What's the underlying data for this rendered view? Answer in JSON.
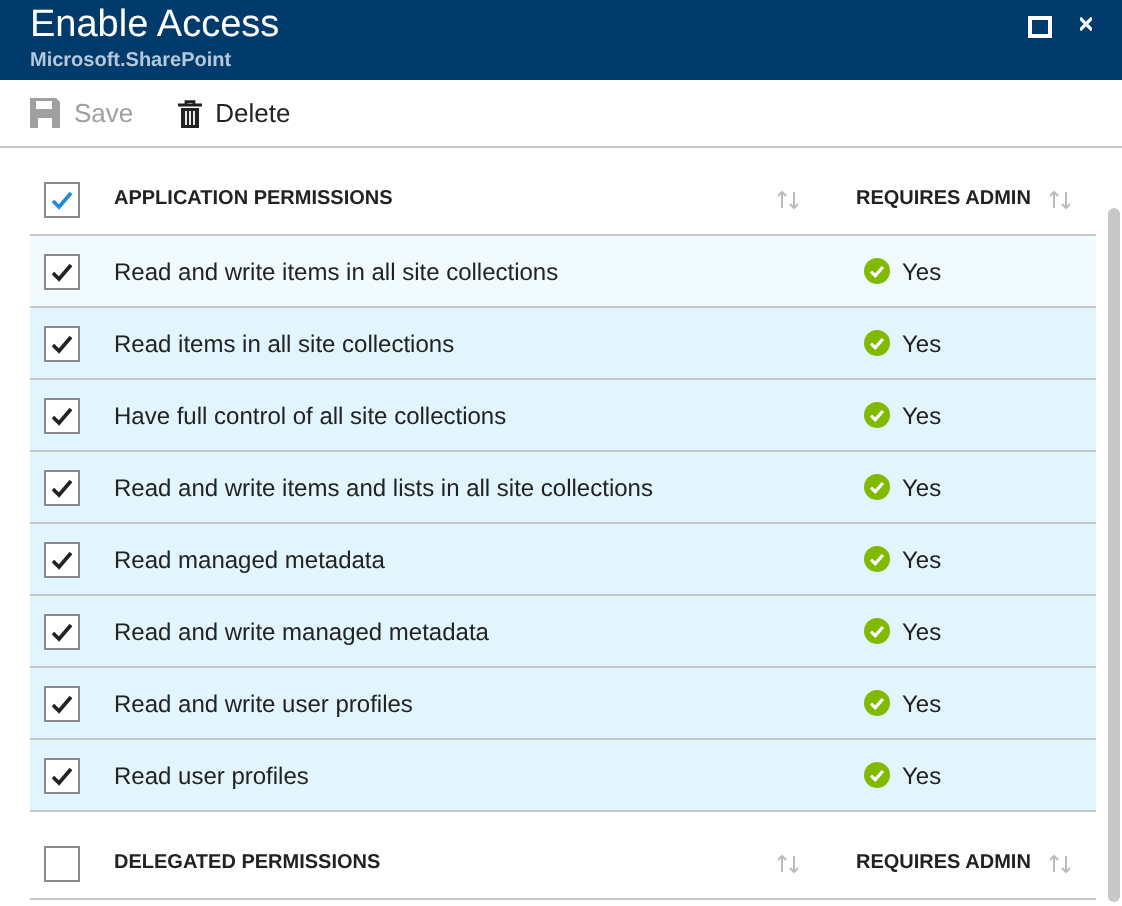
{
  "window": {
    "title": "Enable Access",
    "subtitle": "Microsoft.SharePoint"
  },
  "toolbar": [
    {
      "label": "Save",
      "disabled": true,
      "kind": "save"
    },
    {
      "label": "Delete",
      "disabled": false,
      "kind": "delete"
    }
  ],
  "sections": [
    {
      "all_checked": true,
      "columns": [
        "APPLICATION PERMISSIONS",
        "REQUIRES ADMIN"
      ],
      "rows": [
        {
          "name": "Read and write items in all site collections",
          "checked": true,
          "hovered": true,
          "requires_admin": "Yes"
        },
        {
          "name": "Read items in all site collections",
          "checked": true,
          "hovered": false,
          "requires_admin": "Yes"
        },
        {
          "name": "Have full control of all site collections",
          "checked": true,
          "hovered": false,
          "requires_admin": "Yes"
        },
        {
          "name": "Read and write items and lists in all site collections",
          "checked": true,
          "hovered": false,
          "requires_admin": "Yes"
        },
        {
          "name": "Read managed metadata",
          "checked": true,
          "hovered": false,
          "requires_admin": "Yes"
        },
        {
          "name": "Read and write managed metadata",
          "checked": true,
          "hovered": false,
          "requires_admin": "Yes"
        },
        {
          "name": "Read and write user profiles",
          "checked": true,
          "hovered": false,
          "requires_admin": "Yes"
        },
        {
          "name": "Read user profiles",
          "checked": true,
          "hovered": false,
          "requires_admin": "Yes"
        }
      ]
    },
    {
      "all_checked": false,
      "columns": [
        "DELEGATED PERMISSIONS",
        "REQUIRES ADMIN"
      ]
    }
  ]
}
